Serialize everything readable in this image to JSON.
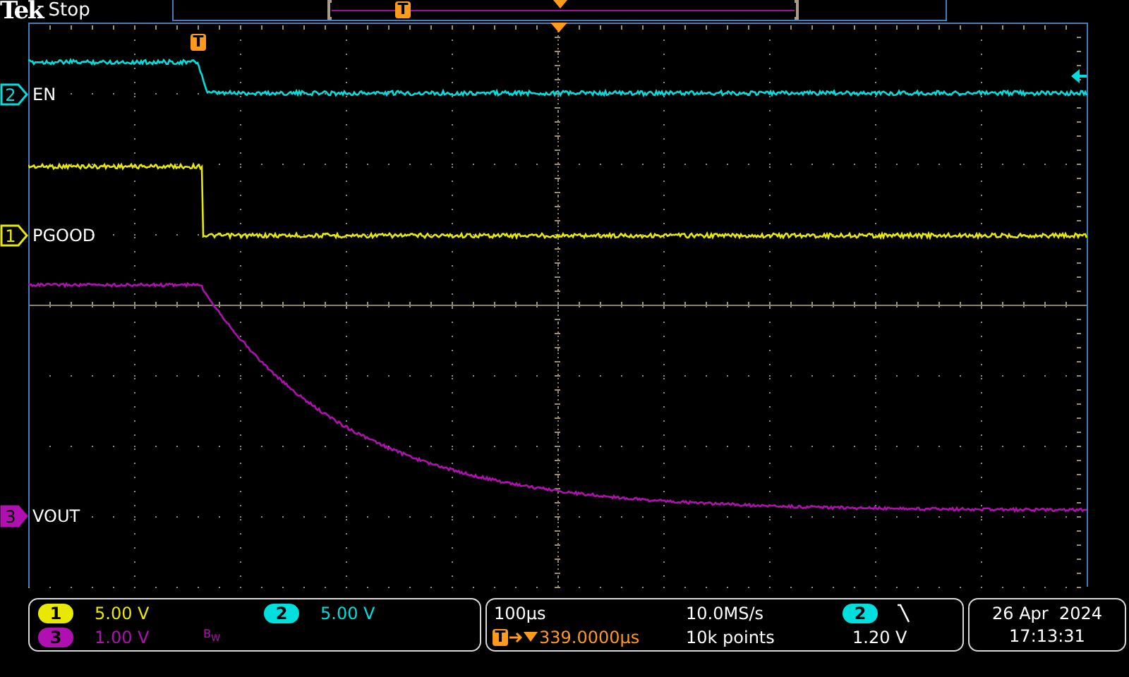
{
  "header": {
    "brand": "Tek",
    "status": "Stop",
    "record_trigger_marker": "T"
  },
  "graticule": {
    "trigger_marker": "T"
  },
  "channels": [
    {
      "number": "2",
      "label": "EN",
      "color": "#00dede",
      "selected": false
    },
    {
      "number": "1",
      "label": "PGOOD",
      "color": "#e8e800",
      "selected": false
    },
    {
      "number": "3",
      "label": "VOUT",
      "color": "#b010b0",
      "selected": true
    }
  ],
  "vertical_readouts": [
    {
      "number": "1",
      "scale": "5.00 V",
      "color": "#e8e800"
    },
    {
      "number": "2",
      "scale": "5.00 V",
      "color": "#00dede"
    },
    {
      "number": "3",
      "scale": "1.00 V",
      "color": "#b010b0",
      "bandwidth_mark": "B$_{W}$"
    }
  ],
  "horizontal": {
    "scale": "100µs",
    "sample_rate": "10.0MS/s",
    "record_length": "10k points",
    "trigger_marker": "T",
    "position": "339.0000µs"
  },
  "trigger": {
    "source": "2",
    "falling_slope": true,
    "level": "1.20 V"
  },
  "clock": {
    "date": "26 Apr  2024",
    "time": "17:13:31"
  }
}
